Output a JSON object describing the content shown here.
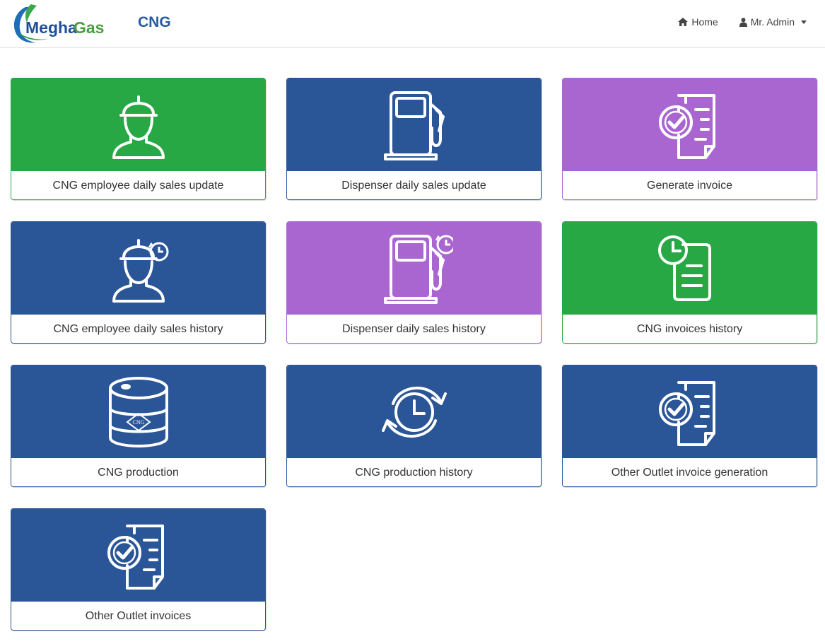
{
  "header": {
    "logo_text_1": "Megha",
    "logo_text_2": "Gas",
    "title": "CNG",
    "home_label": "Home",
    "user_label": "Mr. Admin"
  },
  "colors": {
    "green": "#28a745",
    "blue": "#2a5597",
    "purple": "#a966d1"
  },
  "cards": [
    {
      "label": "CNG employee daily sales update",
      "color": "green",
      "icon": "worker-icon"
    },
    {
      "label": "Dispenser daily sales update",
      "color": "blue",
      "icon": "fuel-pump-icon"
    },
    {
      "label": "Generate invoice",
      "color": "purple",
      "icon": "invoice-check-icon"
    },
    {
      "label": "CNG employee daily sales history",
      "color": "blue",
      "icon": "worker-history-icon"
    },
    {
      "label": "Dispenser daily sales history",
      "color": "purple",
      "icon": "fuel-pump-history-icon"
    },
    {
      "label": "CNG invoices history",
      "color": "green",
      "icon": "clock-document-icon"
    },
    {
      "label": "CNG production",
      "color": "blue",
      "icon": "cng-cylinder-icon",
      "badge": "CNG"
    },
    {
      "label": "CNG production history",
      "color": "blue",
      "icon": "clock-refresh-icon"
    },
    {
      "label": "Other Outlet invoice generation",
      "color": "blue",
      "icon": "invoice-check-icon"
    },
    {
      "label": "Other Outlet invoices",
      "color": "blue",
      "icon": "invoice-check-icon"
    }
  ]
}
